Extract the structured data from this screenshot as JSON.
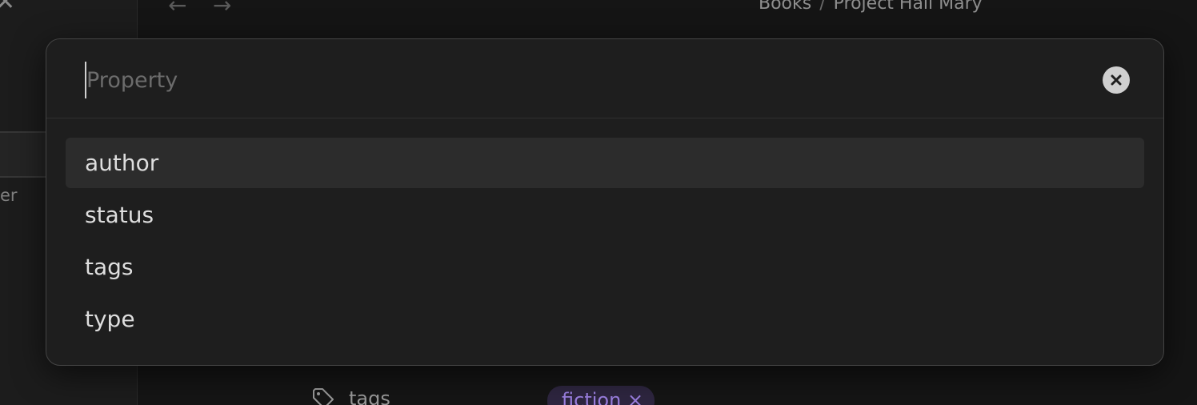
{
  "window": {
    "back_icon": "arrow-left-icon",
    "forward_icon": "arrow-right-icon",
    "close_icon": "close-icon"
  },
  "sidebar": {
    "partial_label": "er"
  },
  "breadcrumb": {
    "parent": "Books",
    "separator": "/",
    "current": "Project Hail Mary"
  },
  "properties": {
    "tags_label": "tags",
    "tag_value": "fiction",
    "tag_remove": "×"
  },
  "property_picker": {
    "search": {
      "placeholder": "Property",
      "value": ""
    },
    "clear_icon": "close-circle-icon",
    "options": [
      {
        "label": "author",
        "selected": true
      },
      {
        "label": "status",
        "selected": false
      },
      {
        "label": "tags",
        "selected": false
      },
      {
        "label": "type",
        "selected": false
      }
    ]
  },
  "colors": {
    "background": "#151515",
    "modal": "#1e1e1e",
    "selected_item": "#2c2c2c",
    "tag_accent": "#9b7fe0"
  }
}
